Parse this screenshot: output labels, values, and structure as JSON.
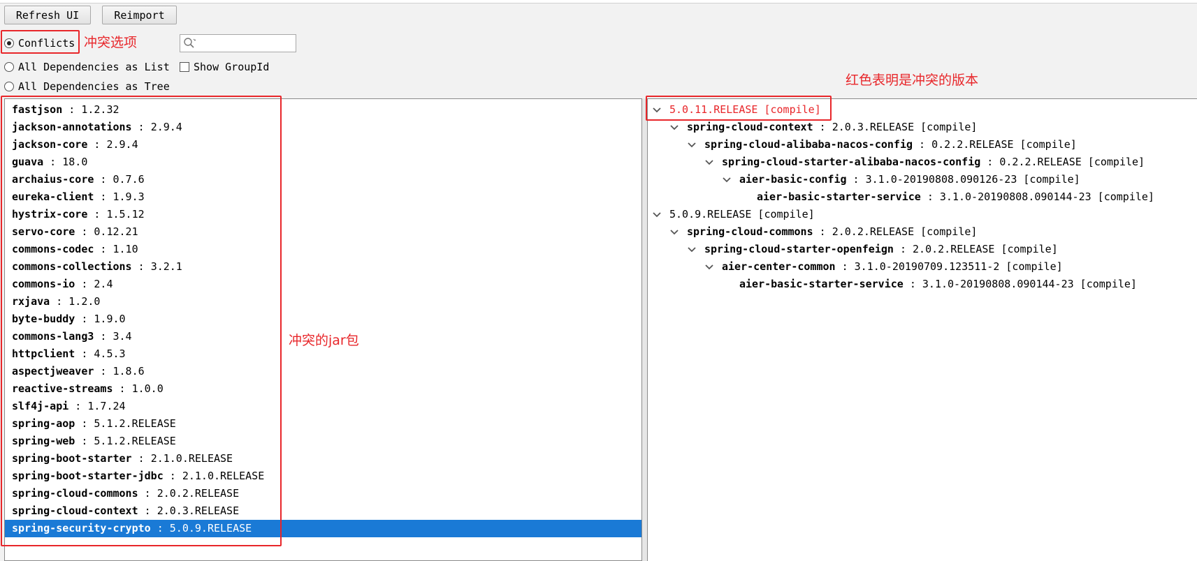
{
  "toolbar": {
    "refresh_label": "Refresh UI",
    "reimport_label": "Reimport"
  },
  "options": {
    "conflicts_label": "Conflicts",
    "list_label": "All Dependencies as List",
    "tree_label": "All Dependencies as Tree",
    "show_groupid_label": "Show GroupId",
    "selected": "conflicts"
  },
  "search": {
    "value": "",
    "placeholder": ""
  },
  "annotations": {
    "conflicts_option": "冲突选项",
    "conflict_jars": "冲突的jar包",
    "red_version": "红色表明是冲突的版本"
  },
  "conflict_list": [
    {
      "name": "fastjson",
      "version": "1.2.32"
    },
    {
      "name": "jackson-annotations",
      "version": "2.9.4"
    },
    {
      "name": "jackson-core",
      "version": "2.9.4"
    },
    {
      "name": "guava",
      "version": "18.0"
    },
    {
      "name": "archaius-core",
      "version": "0.7.6"
    },
    {
      "name": "eureka-client",
      "version": "1.9.3"
    },
    {
      "name": "hystrix-core",
      "version": "1.5.12"
    },
    {
      "name": "servo-core",
      "version": "0.12.21"
    },
    {
      "name": "commons-codec",
      "version": "1.10"
    },
    {
      "name": "commons-collections",
      "version": "3.2.1"
    },
    {
      "name": "commons-io",
      "version": "2.4"
    },
    {
      "name": "rxjava",
      "version": "1.2.0"
    },
    {
      "name": "byte-buddy",
      "version": "1.9.0"
    },
    {
      "name": "commons-lang3",
      "version": "3.4"
    },
    {
      "name": "httpclient",
      "version": "4.5.3"
    },
    {
      "name": "aspectjweaver",
      "version": "1.8.6"
    },
    {
      "name": "reactive-streams",
      "version": "1.0.0"
    },
    {
      "name": "slf4j-api",
      "version": "1.7.24"
    },
    {
      "name": "spring-aop",
      "version": "5.1.2.RELEASE"
    },
    {
      "name": "spring-web",
      "version": "5.1.2.RELEASE"
    },
    {
      "name": "spring-boot-starter",
      "version": "2.1.0.RELEASE"
    },
    {
      "name": "spring-boot-starter-jdbc",
      "version": "2.1.0.RELEASE"
    },
    {
      "name": "spring-cloud-commons",
      "version": "2.0.2.RELEASE"
    },
    {
      "name": "spring-cloud-context",
      "version": "2.0.3.RELEASE"
    },
    {
      "name": "spring-security-crypto",
      "version": "5.0.9.RELEASE",
      "selected": true
    }
  ],
  "tree": [
    {
      "level": 0,
      "expanded": true,
      "name": "",
      "version": "5.0.11.RELEASE [compile]",
      "conflict": true
    },
    {
      "level": 1,
      "expanded": true,
      "name": "spring-cloud-context",
      "version": "2.0.3.RELEASE [compile]"
    },
    {
      "level": 2,
      "expanded": true,
      "name": "spring-cloud-alibaba-nacos-config",
      "version": "0.2.2.RELEASE [compile]"
    },
    {
      "level": 3,
      "expanded": true,
      "name": "spring-cloud-starter-alibaba-nacos-config",
      "version": "0.2.2.RELEASE [compile]"
    },
    {
      "level": 4,
      "expanded": true,
      "name": "aier-basic-config",
      "version": "3.1.0-20190808.090126-23 [compile]"
    },
    {
      "level": 5,
      "expanded": false,
      "leaf": true,
      "name": "aier-basic-starter-service",
      "version": "3.1.0-20190808.090144-23 [compile]"
    },
    {
      "level": 0,
      "expanded": true,
      "name": "",
      "version": "5.0.9.RELEASE [compile]"
    },
    {
      "level": 1,
      "expanded": true,
      "name": "spring-cloud-commons",
      "version": "2.0.2.RELEASE [compile]"
    },
    {
      "level": 2,
      "expanded": true,
      "name": "spring-cloud-starter-openfeign",
      "version": "2.0.2.RELEASE [compile]"
    },
    {
      "level": 3,
      "expanded": true,
      "name": "aier-center-common",
      "version": "3.1.0-20190709.123511-2 [compile]"
    },
    {
      "level": 4,
      "expanded": false,
      "leaf": true,
      "name": "aier-basic-starter-service",
      "version": "3.1.0-20190808.090144-23 [compile]"
    }
  ],
  "colors": {
    "annotation_red": "#e8262a",
    "selection_blue": "#1a7ad6"
  }
}
